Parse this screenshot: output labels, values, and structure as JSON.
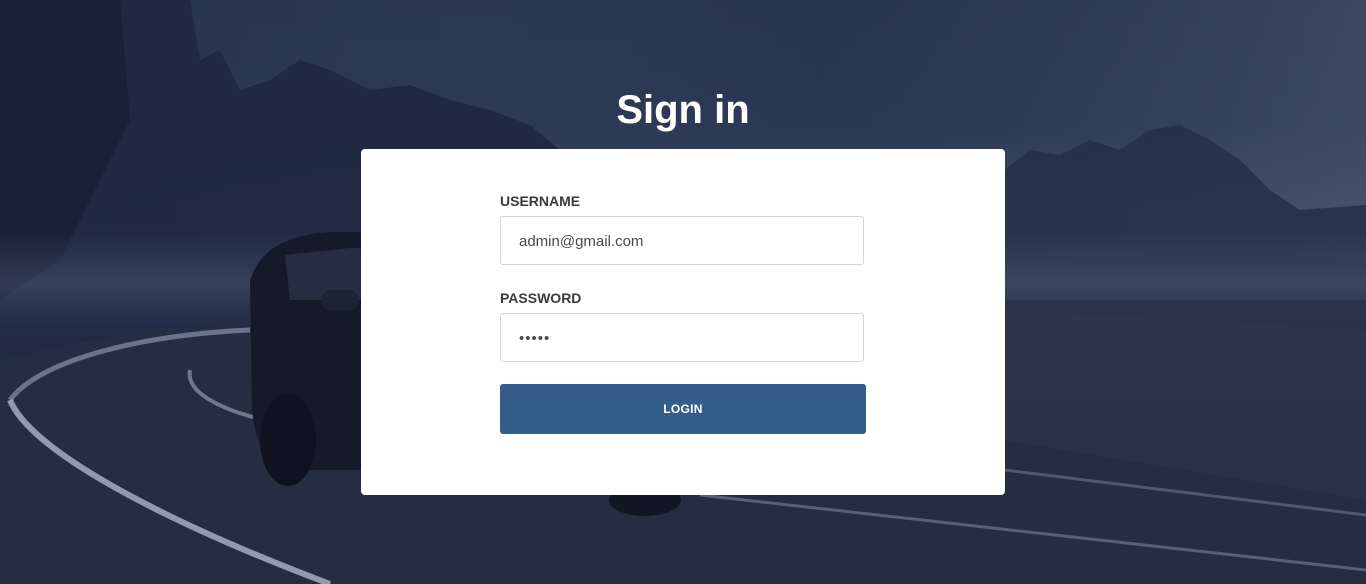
{
  "page": {
    "title": "Sign in"
  },
  "form": {
    "username_label": "USERNAME",
    "username_value": "admin@gmail.com",
    "password_label": "PASSWORD",
    "password_value": "•••••",
    "login_label": "LOGIN"
  },
  "colors": {
    "button": "#325e89",
    "card": "#ffffff",
    "background": "#2c3853"
  }
}
